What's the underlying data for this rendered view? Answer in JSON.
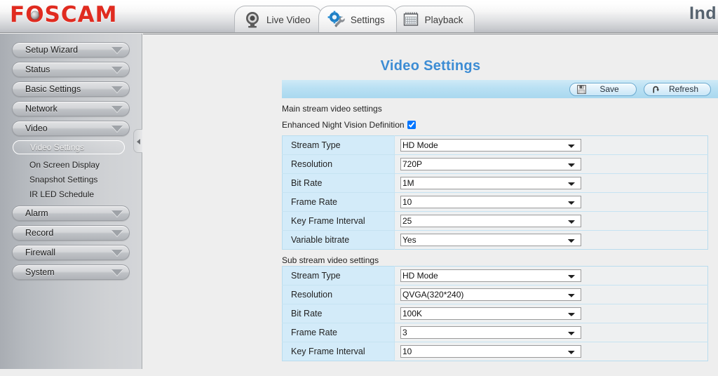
{
  "header": {
    "logo_text": "FOSCAM",
    "logo_color": "#e02b20",
    "device_title": "Ind",
    "tabs": [
      {
        "label": "Live Video",
        "icon": "camera-icon",
        "active": false
      },
      {
        "label": "Settings",
        "icon": "gear-wrench-icon",
        "active": true
      },
      {
        "label": "Playback",
        "icon": "calendar-icon",
        "active": false
      }
    ]
  },
  "sidebar": {
    "items": [
      {
        "label": "Setup Wizard"
      },
      {
        "label": "Status"
      },
      {
        "label": "Basic Settings"
      },
      {
        "label": "Network"
      },
      {
        "label": "Video"
      }
    ],
    "submenu": [
      {
        "label": "Video Settings",
        "selected": true
      },
      {
        "label": "On Screen Display",
        "selected": false
      },
      {
        "label": "Snapshot Settings",
        "selected": false
      },
      {
        "label": "IR LED Schedule",
        "selected": false
      }
    ],
    "items_after": [
      {
        "label": "Alarm"
      },
      {
        "label": "Record"
      },
      {
        "label": "Firewall"
      },
      {
        "label": "System"
      }
    ]
  },
  "main": {
    "title": "Video Settings",
    "title_color": "#3c8cd4",
    "toolbar": {
      "save_label": "Save",
      "refresh_label": "Refresh"
    },
    "main_stream_label": "Main stream video settings",
    "sub_stream_label": "Sub stream video settings",
    "night_vision": {
      "label": "Enhanced Night Vision Definition",
      "checked": true
    },
    "main_stream_rows": [
      {
        "label": "Stream Type",
        "value": "HD Mode"
      },
      {
        "label": "Resolution",
        "value": "720P"
      },
      {
        "label": "Bit Rate",
        "value": "1M"
      },
      {
        "label": "Frame Rate",
        "value": "10"
      },
      {
        "label": "Key Frame Interval",
        "value": "25"
      },
      {
        "label": "Variable bitrate",
        "value": "Yes"
      }
    ],
    "sub_stream_rows": [
      {
        "label": "Stream Type",
        "value": "HD Mode"
      },
      {
        "label": "Resolution",
        "value": "QVGA(320*240)"
      },
      {
        "label": "Bit Rate",
        "value": "100K"
      },
      {
        "label": "Frame Rate",
        "value": "3"
      },
      {
        "label": "Key Frame Interval",
        "value": "10"
      }
    ]
  }
}
